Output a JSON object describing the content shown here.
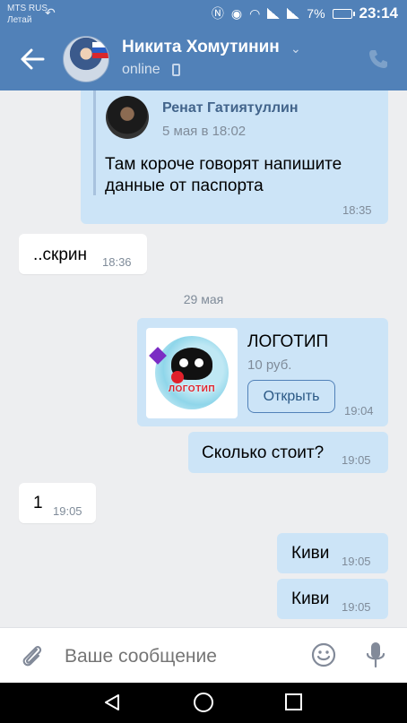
{
  "status_bar": {
    "carrier_line1": "MTS RUS",
    "carrier_line2": "Летай",
    "battery": "7%",
    "clock": "23:14"
  },
  "header": {
    "name": "Никита Хомутинин",
    "status": "online"
  },
  "messages": [
    {
      "direction": "out",
      "quoted": {
        "author": "Ренат Гатиятуллин",
        "date": "5 мая в 18:02"
      },
      "text_line1": "Там короче говорят напишите",
      "text_line2": "данные от паспорта",
      "time": "18:35"
    },
    {
      "direction": "in",
      "text": "..скрин",
      "time": "18:36"
    },
    {
      "direction": "out",
      "product": {
        "title": "ЛОГОТИП",
        "price": "10 руб.",
        "button": "Открыть",
        "thumb_label": "ЛОГОТИП"
      },
      "time": "19:04"
    },
    {
      "direction": "out",
      "text": "Сколько стоит?",
      "time": "19:05"
    },
    {
      "direction": "in",
      "text": "1",
      "time": "19:05"
    },
    {
      "direction": "out",
      "text": "Киви",
      "time": "19:05"
    },
    {
      "direction": "out",
      "text": "Киви",
      "time": "19:05"
    }
  ],
  "day_separator": "29 мая",
  "composer": {
    "placeholder": "Ваше сообщение"
  },
  "colors": {
    "header": "#5181b8",
    "outgoing": "#cce4f7",
    "incoming": "#ffffff",
    "background": "#edeef0"
  },
  "icons": [
    "back-arrow-icon",
    "phone-icon",
    "paperclip-icon",
    "smile-icon",
    "microphone-icon",
    "nav-back-icon",
    "nav-home-icon",
    "nav-recents-icon"
  ]
}
